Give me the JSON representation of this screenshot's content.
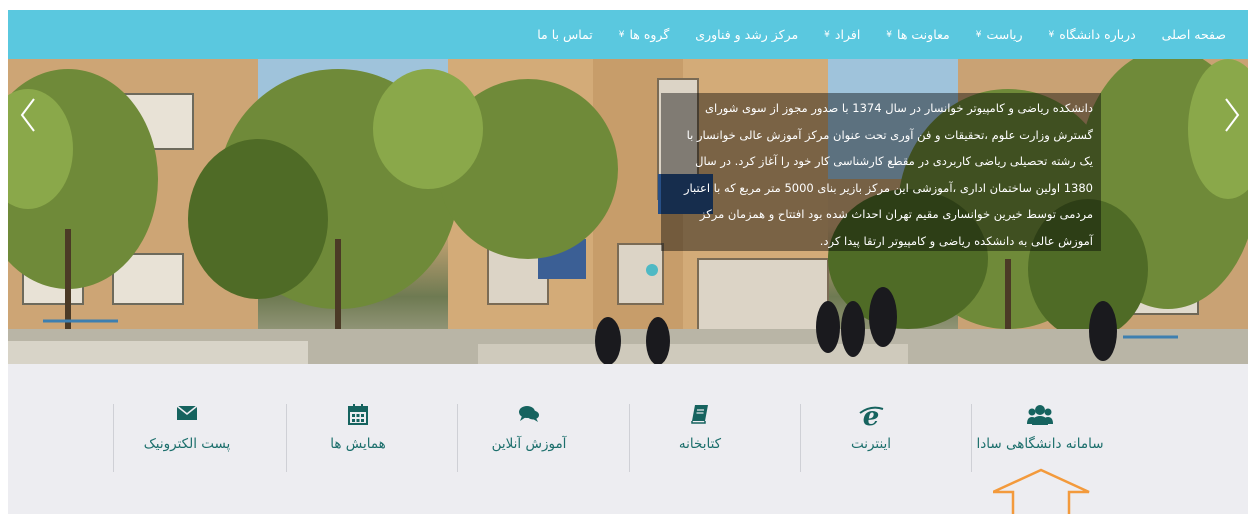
{
  "nav": {
    "items": [
      {
        "label": "صفحه اصلی",
        "dropdown": false
      },
      {
        "label": "درباره دانشگاه",
        "dropdown": true
      },
      {
        "label": "ریاست",
        "dropdown": true
      },
      {
        "label": "معاونت ها",
        "dropdown": true
      },
      {
        "label": "افراد",
        "dropdown": true
      },
      {
        "label": "مرکز رشد و فناوری",
        "dropdown": false
      },
      {
        "label": "گروه ها",
        "dropdown": true
      },
      {
        "label": "تماس با ما",
        "dropdown": false
      }
    ],
    "chevron_glyph": "¥",
    "background": "#5ac8df"
  },
  "hero": {
    "caption": "دانشکده ریاضی و کامپیوتر خوانسار در سال 1374 با صدور مجوز از سوی شورای گسترش وزارت علوم ،تحقیقات و فن آوری تحت عنوان مرکز آموزش عالی خوانسار با یک رشته تحصیلی ریاضی کاربردی در مقطع کارشناسی کار خود را آغاز کرد. در سال 1380 اولین ساختمان اداری ،آموزشی این مرکز بازیر بنای 5000 متر مربع که با اعتبار مردمی توسط خیرین خوانساری مقیم تهران احداث شده بود افتتاح و همزمان مرکز آموزش عالی به دانشکده ریاضی و کامپیوتر ارتقا پیدا کرد.",
    "prev_icon": "chevron-left-icon",
    "next_icon": "chevron-right-icon"
  },
  "quick_links": [
    {
      "label": "سامانه دانشگاهی سادا",
      "icon": "users-icon"
    },
    {
      "label": "اینترنت",
      "icon": "internet-explorer-icon"
    },
    {
      "label": "کتابخانه",
      "icon": "book-icon"
    },
    {
      "label": "آموزش آنلاین",
      "icon": "comments-icon"
    },
    {
      "label": "همایش ها",
      "icon": "calendar-icon"
    },
    {
      "label": "پست الکترونیک",
      "icon": "envelope-icon"
    }
  ],
  "colors": {
    "accent": "#5ac8df",
    "link_text": "#1c6f6c",
    "quick_bg": "#ededf1",
    "annotation_arrow": "#f39a3c"
  }
}
